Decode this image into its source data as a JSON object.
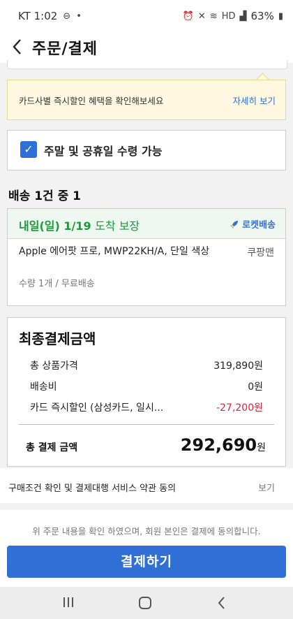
{
  "status_bar": {
    "carrier_time": "KT 1:02",
    "battery": "63%"
  },
  "header": {
    "title": "주문/결제"
  },
  "tooltip": {
    "text": "카드사별 즉시할인 혜택을 확인해보세요",
    "link": "자세히 보기"
  },
  "weekend_option": {
    "label": "주말 및 공휴일 수령 가능",
    "checked": true
  },
  "shipment": {
    "heading": "배송 1건 중 1",
    "arrival_date": "내일(일) 1/19",
    "arrival_suffix": "도착 보장",
    "badge": "로켓배송",
    "product_name": "Apple 에어팟 프로, MWP22KH/A, 단일 색상",
    "seller": "쿠팡맨",
    "quantity": "수량 1개 / 무료배송"
  },
  "payment": {
    "title": "최종결제금액",
    "rows": [
      {
        "label": "총 상품가격",
        "value": "319,890원"
      },
      {
        "label": "배송비",
        "value": "0원"
      },
      {
        "label": "카드 즉시할인 (삼성카드, 일시...",
        "value": "-27,200원"
      }
    ],
    "total_label": "총 결제 금액",
    "total_value": "292,690",
    "total_unit": "원"
  },
  "terms": {
    "text": "구매조건 확인 및 결제대행 서비스 약관 동의",
    "link": "보기"
  },
  "agreement": "위 주문 내용을 확인 하였으며, 회원 본인은 결제에 동의합니다.",
  "pay_button": "결제하기",
  "colors": {
    "accent": "#2f6fd6",
    "arrival_green": "#1c9a3c",
    "discount_red": "#d8273b"
  },
  "icons": [
    "back-arrow-icon",
    "checkbox-checked-icon",
    "rocket-icon",
    "recents-icon",
    "home-icon",
    "nav-back-icon"
  ]
}
